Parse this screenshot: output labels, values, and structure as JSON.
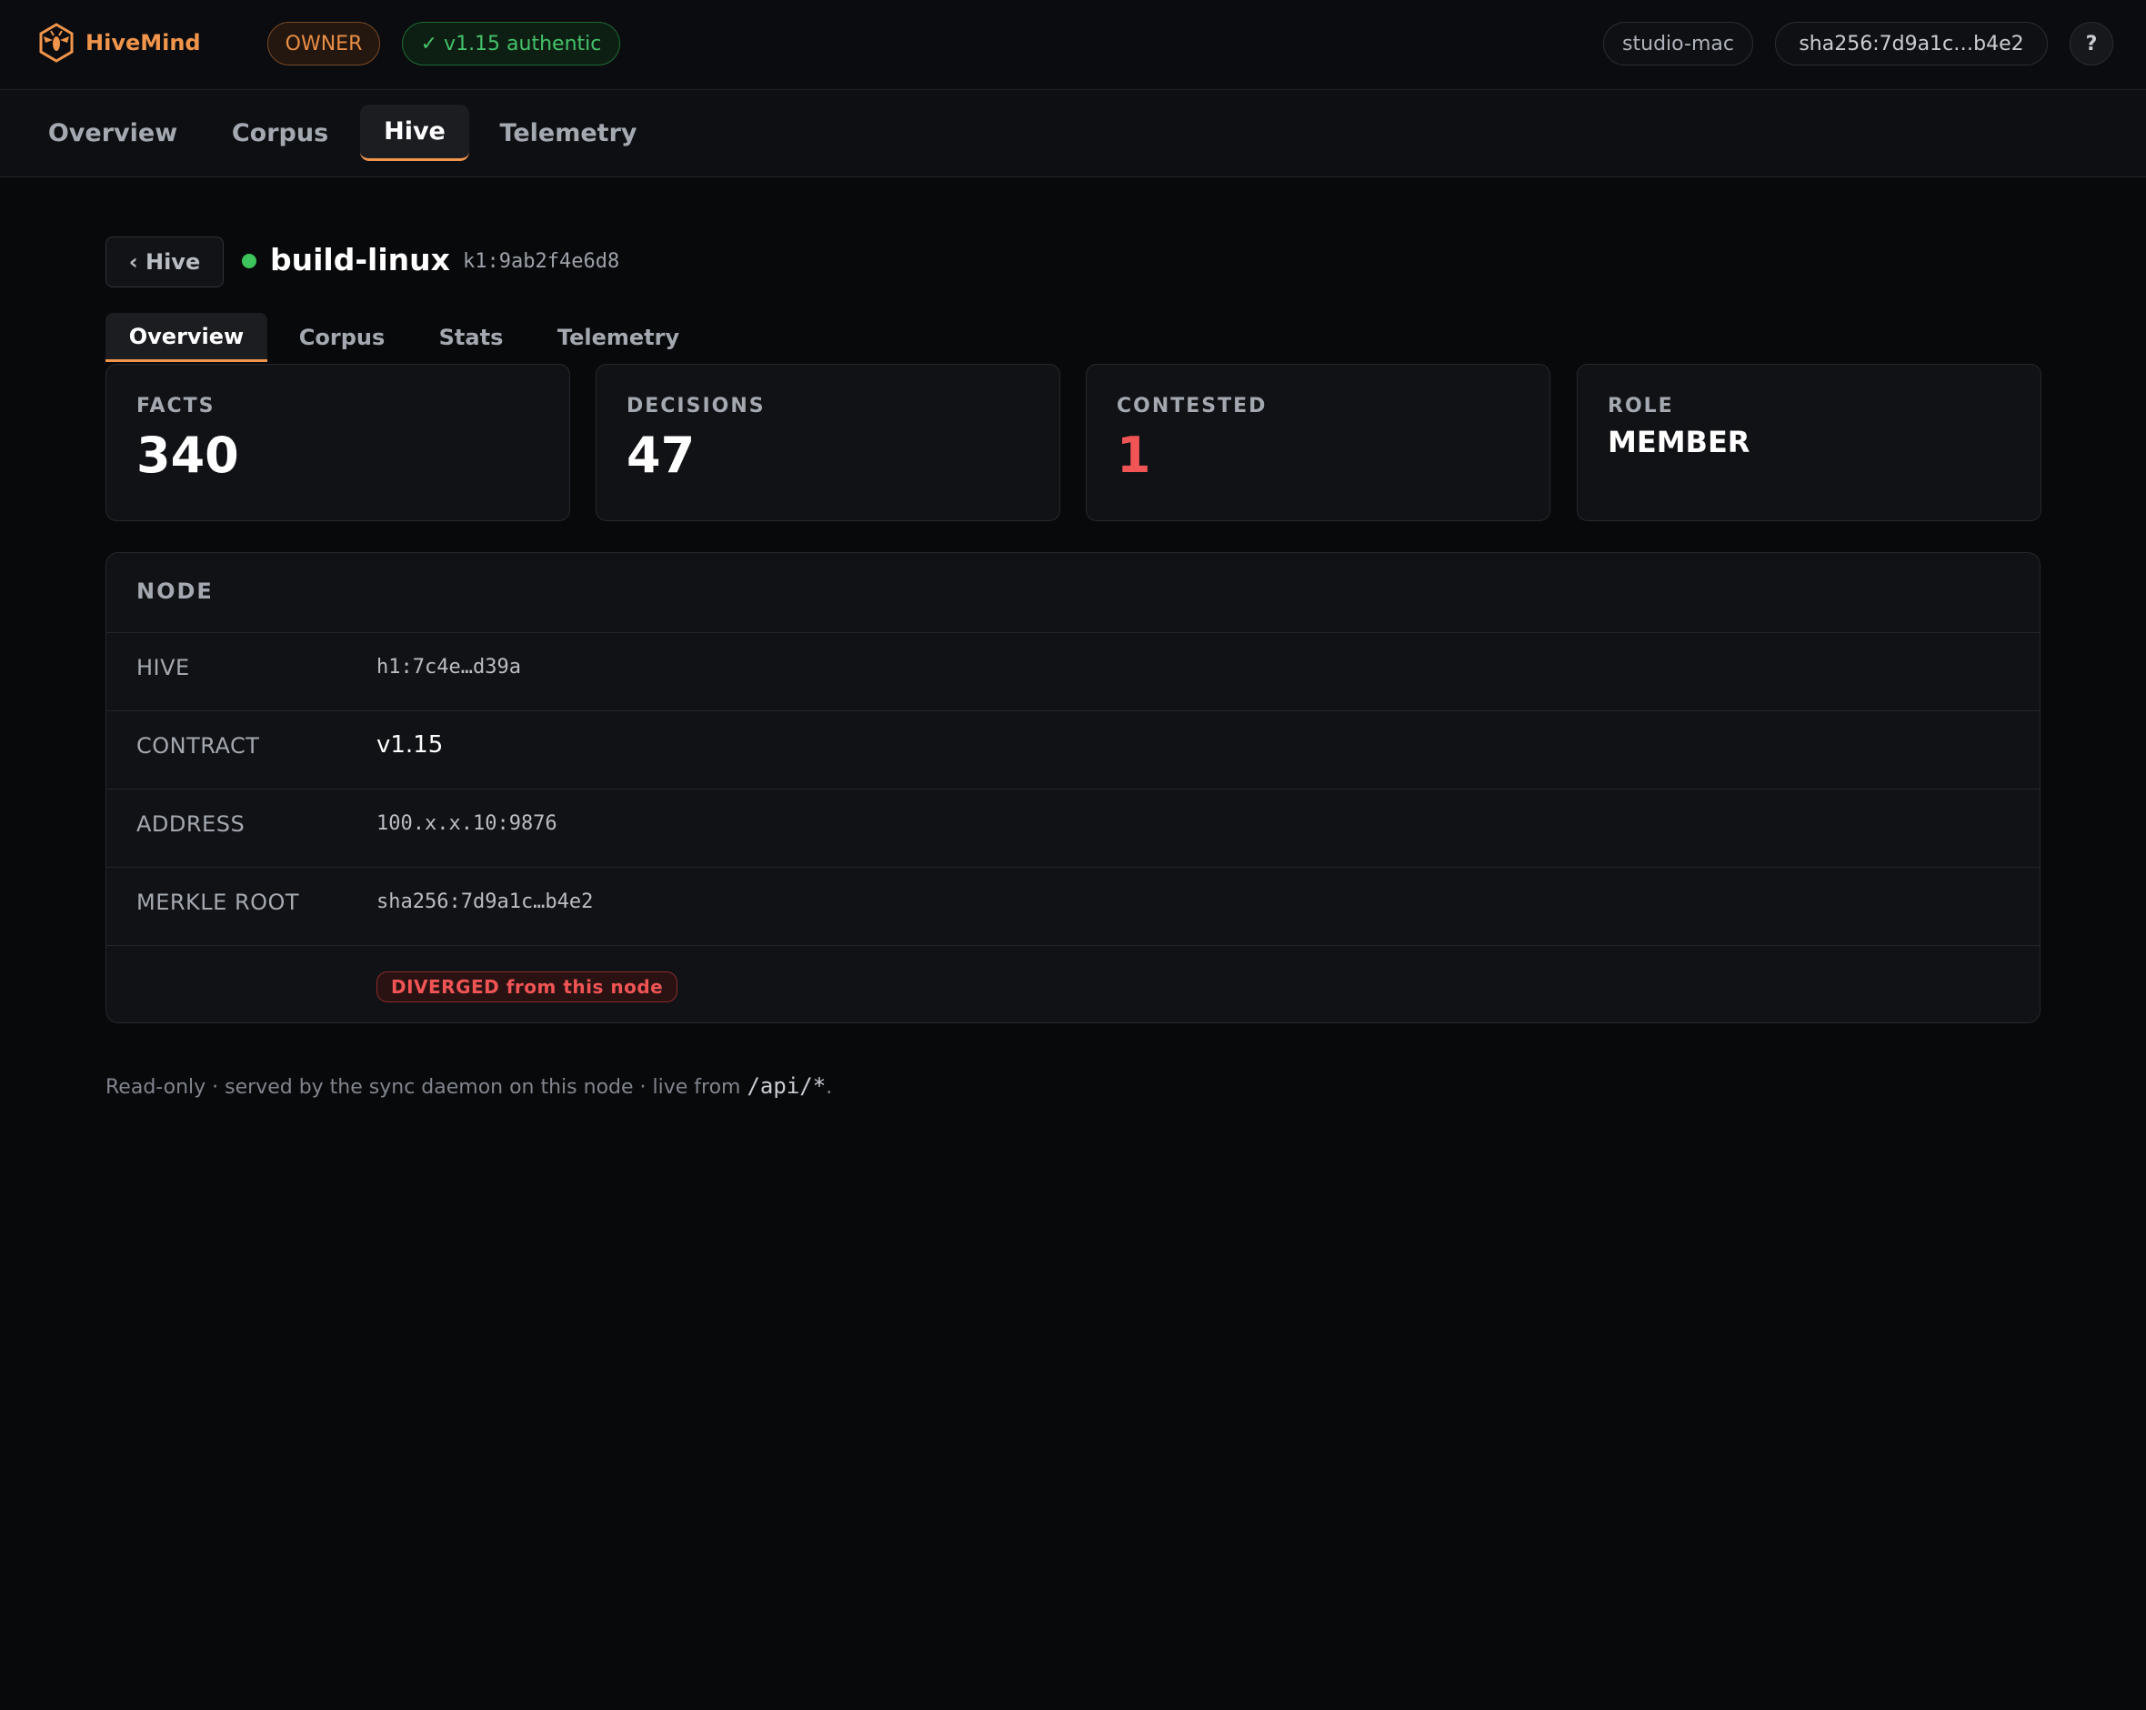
{
  "app": {
    "name": "HiveMind",
    "logo_icon": "bee-hexagon-icon",
    "accent_color": "#f0954b"
  },
  "topbar": {
    "role_badge": "OWNER",
    "auth_badge": "✓ v1.15 authentic",
    "host": "studio-mac",
    "hash": "sha256:7d9a1c…b4e2",
    "help_label": "?"
  },
  "main_nav": {
    "tabs": [
      {
        "label": "Overview",
        "active": false
      },
      {
        "label": "Corpus",
        "active": false
      },
      {
        "label": "Hive",
        "active": true
      },
      {
        "label": "Telemetry",
        "active": false
      }
    ]
  },
  "header": {
    "back_label": "‹ Hive",
    "status": "online",
    "status_color": "#3dc45c",
    "node_name": "build-linux",
    "node_key": "k1:9ab2f4e6d8"
  },
  "sub_tabs": [
    {
      "label": "Overview",
      "active": true
    },
    {
      "label": "Corpus",
      "active": false
    },
    {
      "label": "Stats",
      "active": false
    },
    {
      "label": "Telemetry",
      "active": false
    }
  ],
  "stats": [
    {
      "label": "FACTS",
      "value": "340"
    },
    {
      "label": "DECISIONS",
      "value": "47"
    },
    {
      "label": "CONTESTED",
      "value": "1",
      "color": "#f05454"
    },
    {
      "label": "ROLE",
      "value": "MEMBER"
    }
  ],
  "node_panel": {
    "title": "NODE",
    "rows": [
      {
        "label": "HIVE",
        "value": "h1:7c4e…d39a"
      },
      {
        "label": "CONTRACT",
        "value": "v1.15"
      },
      {
        "label": "ADDRESS",
        "value": "100.x.x.10:9876"
      },
      {
        "label": "MERKLE ROOT",
        "value": "sha256:7d9a1c…b4e2"
      }
    ],
    "divergence_badge": "DIVERGED from this node"
  },
  "footer": {
    "text": "Read-only · served by the sync daemon on this node · live from ",
    "code": "/api/*",
    "end": "."
  }
}
